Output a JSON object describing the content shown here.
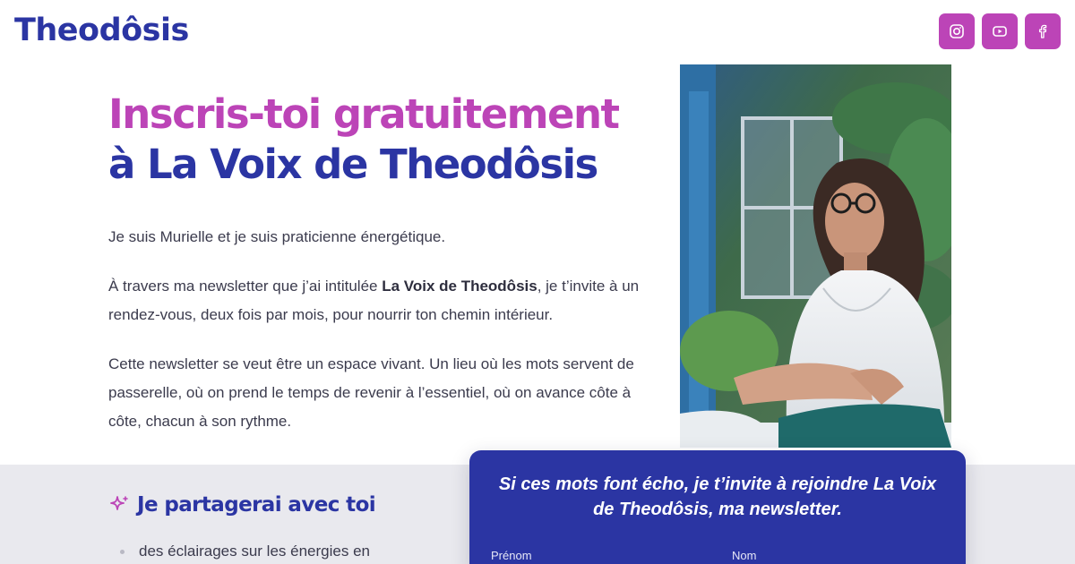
{
  "header": {
    "logo": "Theodôsis",
    "socials": [
      {
        "name": "instagram",
        "icon": "instagram-icon"
      },
      {
        "name": "youtube",
        "icon": "youtube-icon"
      },
      {
        "name": "facebook",
        "icon": "facebook-icon"
      }
    ]
  },
  "hero": {
    "title_line1": "Inscris-toi gratuitement",
    "title_line2": "à La Voix de Theodôsis",
    "intro": "Je suis Murielle et je suis praticienne énergétique.",
    "p2_before": "À travers ma newsletter que j’ai intitulée ",
    "p2_bold": "La Voix de Theodôsis",
    "p2_after": ", je t’invite à un rendez-vous, deux fois par mois, pour nourrir ton chemin intérieur.",
    "p3": "Cette newsletter se veut être un espace vivant. Un lieu où les mots servent de passerelle, où on prend le temps de revenir à l’essentiel, où on avance côte à côte, chacun à son rythme."
  },
  "share": {
    "title": "Je partagerai avec toi",
    "items": [
      "des éclairages sur les énergies en"
    ]
  },
  "signup": {
    "heading": "Si ces mots font écho, je t’invite à rejoindre La Voix de Theodôsis, ma newsletter.",
    "first_name_label": "Prénom",
    "last_name_label": "Nom"
  },
  "colors": {
    "brand_blue": "#2b35a3",
    "brand_pink": "#bc44b7",
    "band_gray": "#e9e9ee"
  }
}
